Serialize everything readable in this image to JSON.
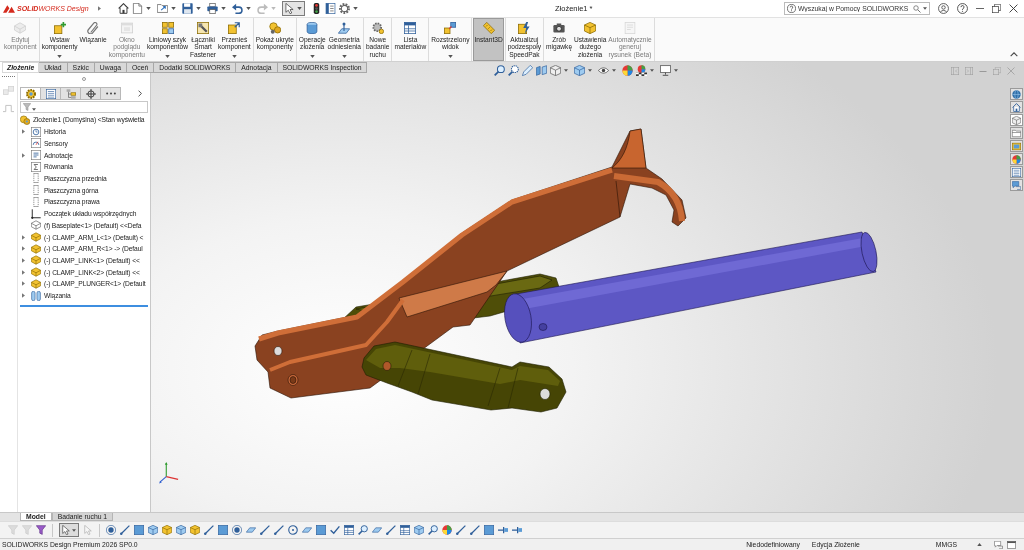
{
  "window": {
    "logo": "**SOLID**WORKS Design",
    "title": "Złożenie1 *"
  },
  "quick_access": [
    {
      "disabled": false,
      "pressed": false
    },
    {
      "disabled": false,
      "pressed": false
    },
    {
      "disabled": false,
      "pressed": false
    },
    {
      "disabled": false,
      "pressed": false
    },
    {
      "disabled": false,
      "pressed": false
    },
    {
      "disabled": false,
      "pressed": false
    },
    {
      "disabled": true,
      "pressed": false
    },
    {
      "disabled": false,
      "pressed": true
    },
    {
      "disabled": false,
      "pressed": false
    },
    {
      "disabled": false,
      "pressed": false
    },
    {
      "disabled": false,
      "pressed": false
    }
  ],
  "help_search": {
    "placeholder": "Wyszukaj w Pomocy SOLIDWORKS"
  },
  "ribbon": {
    "groups": [
      {
        "buttons": [
          {
            "label": "Edytuj\nkomponent",
            "disabled": true,
            "pressed": false,
            "dropdown": false
          }
        ]
      },
      {
        "buttons": [
          {
            "label": "Wstaw\nkomponenty",
            "disabled": false,
            "pressed": false,
            "dropdown": true
          },
          {
            "label": "Wiązanie",
            "disabled": false,
            "pressed": false,
            "dropdown": false
          },
          {
            "label": "Okno\npodglądu\nkomponentu",
            "disabled": true,
            "pressed": false,
            "dropdown": false
          },
          {
            "label": "Liniowy szyk\nkomponentów",
            "disabled": false,
            "pressed": false,
            "dropdown": true
          },
          {
            "label": "Łączniki\nSmart\nFastener",
            "disabled": false,
            "pressed": false,
            "dropdown": false
          },
          {
            "label": "Przenieś\nkomponent",
            "disabled": false,
            "pressed": false,
            "dropdown": true
          }
        ]
      },
      {
        "buttons": [
          {
            "label": "Pokaż ukryte\nkomponenty",
            "disabled": false,
            "pressed": false,
            "dropdown": false
          }
        ]
      },
      {
        "buttons": [
          {
            "label": "Operacje\nzłożenia",
            "disabled": false,
            "pressed": false,
            "dropdown": true
          },
          {
            "label": "Geometria\nodniesienia",
            "disabled": false,
            "pressed": false,
            "dropdown": true
          }
        ]
      },
      {
        "buttons": [
          {
            "label": "Nowe\nbadanie\nruchu",
            "disabled": false,
            "pressed": false,
            "dropdown": false
          }
        ]
      },
      {
        "buttons": [
          {
            "label": "Lista\nmateriałów",
            "disabled": false,
            "pressed": false,
            "dropdown": false
          }
        ]
      },
      {
        "buttons": [
          {
            "label": "Rozstrzelony\nwidok",
            "disabled": false,
            "pressed": false,
            "dropdown": true
          }
        ]
      },
      {
        "buttons": [
          {
            "label": "Instant3D",
            "disabled": false,
            "pressed": true,
            "dropdown": false
          }
        ]
      },
      {
        "buttons": [
          {
            "label": "Aktualizuj\npodzespoły\nSpeedPak",
            "disabled": false,
            "pressed": false,
            "dropdown": false
          }
        ]
      },
      {
        "buttons": [
          {
            "label": "Zrób\nmigawkę",
            "disabled": false,
            "pressed": false,
            "dropdown": false
          },
          {
            "label": "Ustawienia\ndużego\nzłożenia",
            "disabled": false,
            "pressed": false,
            "dropdown": false
          },
          {
            "label": "Automatycznie\ngeneruj\nrysunek (Beta)",
            "disabled": true,
            "pressed": false,
            "dropdown": false
          }
        ]
      }
    ]
  },
  "command_tabs": [
    {
      "label": "Złożenie",
      "selected": true
    },
    {
      "label": "Układ",
      "selected": false
    },
    {
      "label": "Szkic",
      "selected": false
    },
    {
      "label": "Uwaga",
      "selected": false
    },
    {
      "label": "Oceń",
      "selected": false
    },
    {
      "label": "Dodatki SOLIDWORKS",
      "selected": false
    },
    {
      "label": "Adnotacja",
      "selected": false
    },
    {
      "label": "SOLIDWORKS Inspection",
      "selected": false
    }
  ],
  "side_tools": [
    {
      "disabled": true
    },
    {
      "disabled": true
    }
  ],
  "feature_manager": {
    "tabs": [
      {
        "selected": true
      },
      {
        "selected": false
      },
      {
        "selected": false
      },
      {
        "selected": false
      },
      {
        "selected": false
      }
    ],
    "tree": {
      "label": "Złożenie1 (Domyślna) <Stan wyświetla",
      "kind": "assembly",
      "children": [
        {
          "label": "Historia",
          "kind": "history",
          "expander": true
        },
        {
          "label": "Sensory",
          "kind": "sensors",
          "expander": false
        },
        {
          "label": "Adnotacje",
          "kind": "annotations",
          "expander": true
        },
        {
          "label": "Równania",
          "kind": "equations",
          "expander": false
        },
        {
          "label": "Płaszczyzna przednia",
          "kind": "plane",
          "expander": false
        },
        {
          "label": "Płaszczyzna górna",
          "kind": "plane",
          "expander": false
        },
        {
          "label": "Płaszczyzna prawa",
          "kind": "plane",
          "expander": false
        },
        {
          "label": "Początek układu współrzędnych",
          "kind": "origin",
          "expander": false
        },
        {
          "label": "(f) Baseplate<1> (Default) <<Defa",
          "kind": "fixed_part",
          "expander": false
        },
        {
          "label": "(-) CLAMP_ARM_L<1> (Default) <",
          "kind": "part",
          "expander": true
        },
        {
          "label": "(-) CLAMP_ARM_R<1> -> (Defaul",
          "kind": "part",
          "expander": true
        },
        {
          "label": "(-) CLAMP_LINK<1> (Default) <<",
          "kind": "part",
          "expander": true
        },
        {
          "label": "(-) CLAMP_LINK<2> (Default) <<",
          "kind": "part",
          "expander": true
        },
        {
          "label": "(-) CLAMP_PLUNGER<1> (Default",
          "kind": "part",
          "expander": true
        },
        {
          "label": "Wiązania",
          "kind": "mates",
          "expander": true
        }
      ]
    }
  },
  "task_pane": [
    {
      "selected": false
    },
    {
      "selected": false
    },
    {
      "selected": true
    },
    {
      "selected": false
    },
    {
      "selected": false
    },
    {
      "selected": false
    },
    {
      "selected": false
    },
    {
      "selected": false
    }
  ],
  "bottom_tabs": [
    {
      "label": "Model",
      "selected": true
    },
    {
      "label": "Badanie ruchu 1",
      "selected": false
    }
  ],
  "selection_filter_toolbar": [
    {
      "disabled": true,
      "pressed": false
    },
    {
      "disabled": true,
      "pressed": false
    },
    {
      "disabled": false,
      "pressed": false
    },
    {
      "disabled": false,
      "pressed": true
    },
    {
      "disabled": true,
      "pressed": false
    },
    {
      "disabled": false,
      "pressed": false
    },
    {
      "disabled": false,
      "pressed": false
    },
    {
      "disabled": false,
      "pressed": false
    },
    {
      "disabled": false,
      "pressed": false
    },
    {
      "disabled": false,
      "pressed": false
    },
    {
      "disabled": false,
      "pressed": false
    },
    {
      "disabled": false,
      "pressed": false
    },
    {
      "disabled": false,
      "pressed": false
    },
    {
      "disabled": false,
      "pressed": false
    },
    {
      "disabled": false,
      "pressed": false
    },
    {
      "disabled": false,
      "pressed": false
    },
    {
      "disabled": false,
      "pressed": false
    },
    {
      "disabled": false,
      "pressed": false
    },
    {
      "disabled": false,
      "pressed": false
    },
    {
      "disabled": false,
      "pressed": false
    },
    {
      "disabled": false,
      "pressed": false
    },
    {
      "disabled": false,
      "pressed": false
    },
    {
      "disabled": false,
      "pressed": false
    },
    {
      "disabled": false,
      "pressed": false
    },
    {
      "disabled": false,
      "pressed": false
    },
    {
      "disabled": false,
      "pressed": false
    },
    {
      "disabled": false,
      "pressed": false
    },
    {
      "disabled": false,
      "pressed": false
    },
    {
      "disabled": false,
      "pressed": false
    },
    {
      "disabled": false,
      "pressed": false
    },
    {
      "disabled": false,
      "pressed": false
    },
    {
      "disabled": false,
      "pressed": false
    },
    {
      "disabled": false,
      "pressed": false
    },
    {
      "disabled": false,
      "pressed": false
    },
    {
      "disabled": false,
      "pressed": false
    }
  ],
  "status_bar": {
    "product": "SOLIDWORKS Design Premium 2026 SP0.0",
    "definition": "Niedodefiniowany",
    "mode": "Edycja Złożenie",
    "units": "MMGS"
  }
}
